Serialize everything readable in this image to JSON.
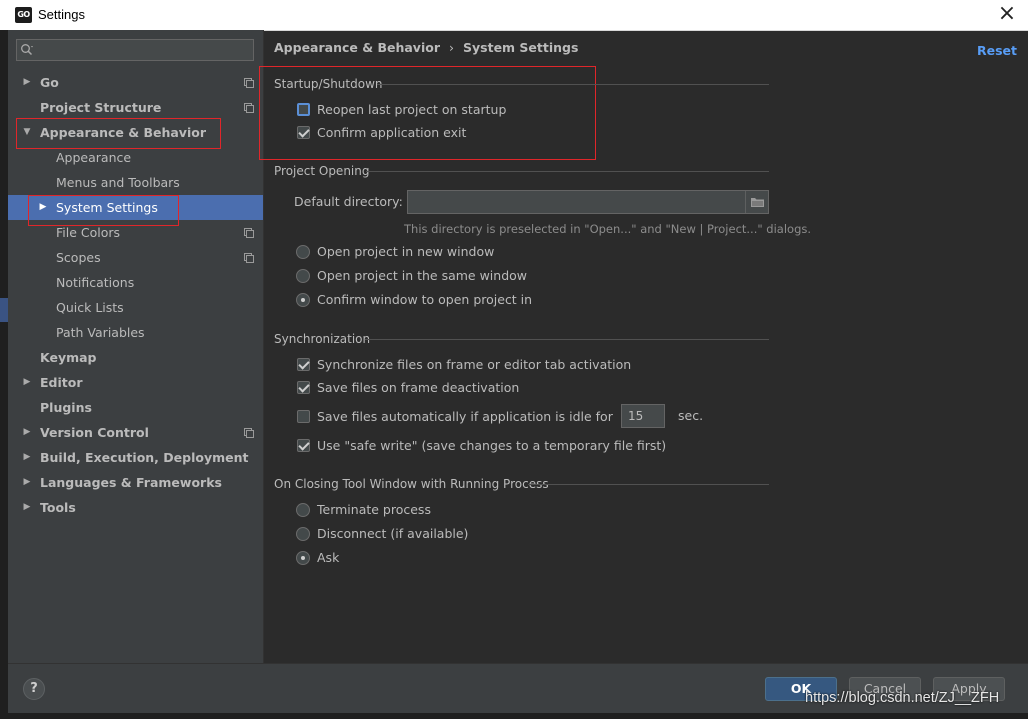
{
  "window": {
    "logo_text": "GO",
    "title": "Settings"
  },
  "search": {
    "placeholder": ""
  },
  "sidebar": {
    "items": [
      {
        "label": "Go"
      },
      {
        "label": "Project Structure"
      },
      {
        "label": "Appearance & Behavior"
      },
      {
        "label": "Appearance"
      },
      {
        "label": "Menus and Toolbars"
      },
      {
        "label": "System Settings"
      },
      {
        "label": "File Colors"
      },
      {
        "label": "Scopes"
      },
      {
        "label": "Notifications"
      },
      {
        "label": "Quick Lists"
      },
      {
        "label": "Path Variables"
      },
      {
        "label": "Keymap"
      },
      {
        "label": "Editor"
      },
      {
        "label": "Plugins"
      },
      {
        "label": "Version Control"
      },
      {
        "label": "Build, Execution, Deployment"
      },
      {
        "label": "Languages & Frameworks"
      },
      {
        "label": "Tools"
      }
    ]
  },
  "header": {
    "breadcrumb": [
      "Appearance & Behavior",
      "System Settings"
    ],
    "separator": "›",
    "reset_label": "Reset"
  },
  "startup": {
    "title": "Startup/Shutdown",
    "reopen_label": "Reopen last project on startup",
    "reopen_checked": false,
    "confirm_exit_label": "Confirm application exit",
    "confirm_exit_checked": true
  },
  "project_opening": {
    "title": "Project Opening",
    "default_dir_label": "Default directory:",
    "default_dir_value": "",
    "hint": "This directory is preselected in \"Open...\" and \"New | Project...\" dialogs.",
    "options": [
      {
        "label": "Open project in new window",
        "selected": false
      },
      {
        "label": "Open project in the same window",
        "selected": false
      },
      {
        "label": "Confirm window to open project in",
        "selected": true
      }
    ]
  },
  "synchronization": {
    "title": "Synchronization",
    "sync_label": "Synchronize files on frame or editor tab activation",
    "sync_checked": true,
    "save_deactivation_label": "Save files on frame deactivation",
    "save_deactivation_checked": true,
    "save_idle_label": "Save files automatically if application is idle for",
    "save_idle_checked": false,
    "idle_seconds": "15",
    "idle_unit": "sec.",
    "safe_write_label": "Use \"safe write\" (save changes to a temporary file first)",
    "safe_write_checked": true
  },
  "closing": {
    "title": "On Closing Tool Window with Running Process",
    "options": [
      {
        "label": "Terminate process",
        "selected": false
      },
      {
        "label": "Disconnect (if available)",
        "selected": false
      },
      {
        "label": "Ask",
        "selected": true
      }
    ]
  },
  "footer": {
    "help_label": "?",
    "ok_label": "OK",
    "cancel_label": "Cancel",
    "apply_label": "Apply"
  },
  "watermark": "https://blog.csdn.net/ZJ__ZFH",
  "colors": {
    "background": "#2b2b2b",
    "sidebar": "#3c3f41",
    "selection": "#4b6eaf",
    "link": "#589df6",
    "primary_button": "#365880",
    "annotation_red": "#e0262a"
  }
}
